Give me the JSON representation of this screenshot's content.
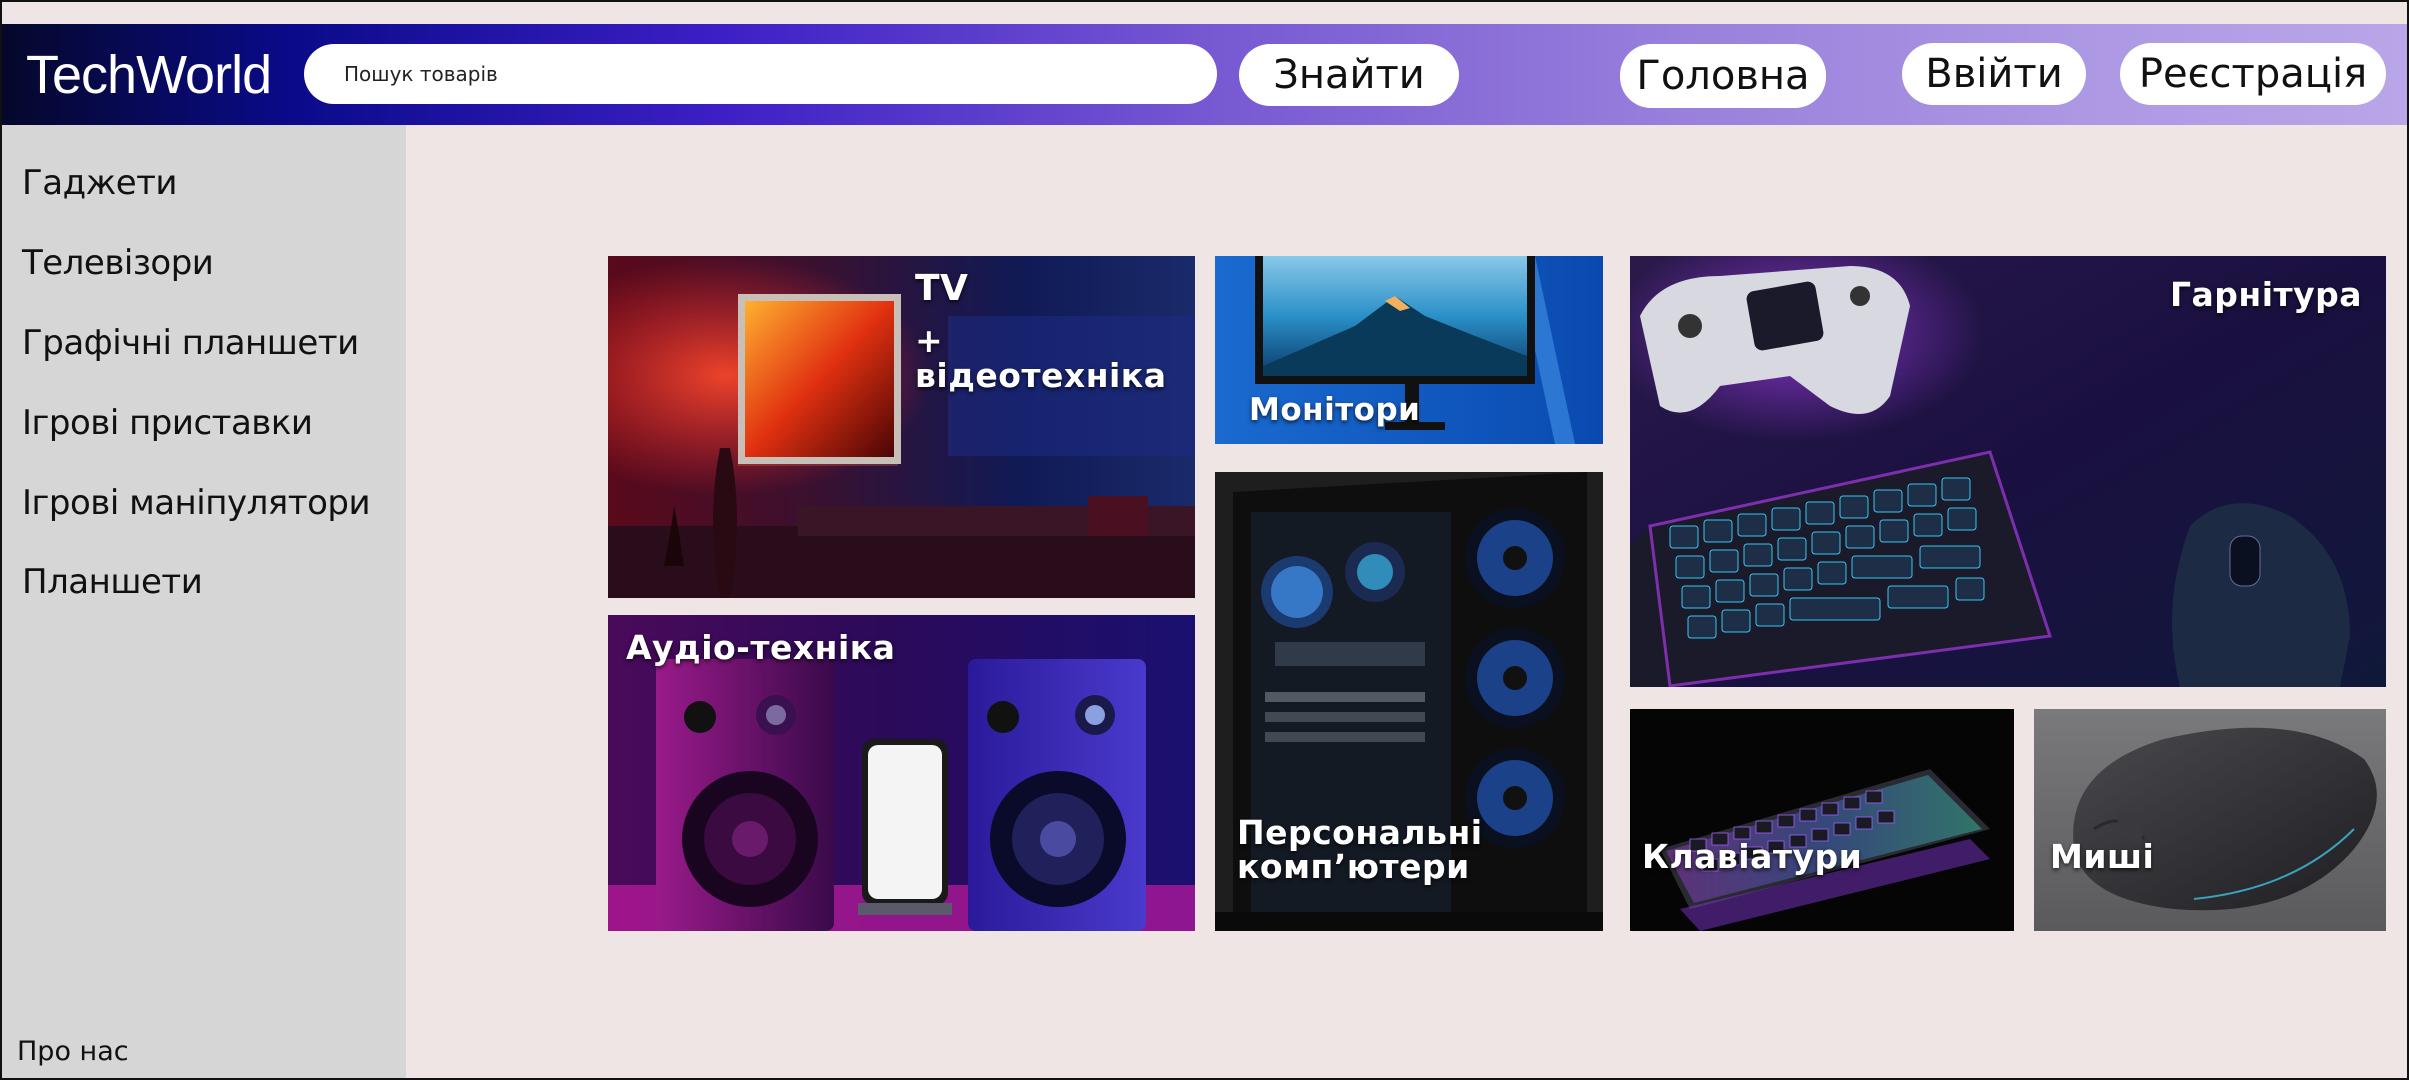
{
  "header": {
    "logo": "TechWorld",
    "search_placeholder": "Пошук товарів",
    "search_button": "Знайти",
    "nav": {
      "home": "Головна",
      "login": "Ввійти",
      "register": "Реєстрація"
    }
  },
  "sidebar": {
    "items": [
      {
        "label": "Гаджети"
      },
      {
        "label": "Телевізори"
      },
      {
        "label": "Графічні планшети"
      },
      {
        "label": "Ігрові приставки"
      },
      {
        "label": "Ігрові маніпулятори"
      },
      {
        "label": "Планшети"
      }
    ],
    "about": "Про нас"
  },
  "tiles": {
    "tv": {
      "line1": "TV",
      "line2": "+ відеотехніка"
    },
    "audio": {
      "label": "Аудіо-техніка"
    },
    "monitors": {
      "label": "Монітори"
    },
    "pc": {
      "line1": "Персональні",
      "line2": "комп’ютери"
    },
    "headset": {
      "label": "Гарнітура"
    },
    "keyboards": {
      "label": "Клавіатури"
    },
    "mice": {
      "label": "Миші"
    }
  },
  "colors": {
    "background": "#efe5e5",
    "sidebar": "#d6d6d6",
    "header_start": "#05082a",
    "header_mid": "#3d1fc6",
    "header_end": "#b9a6e8"
  }
}
